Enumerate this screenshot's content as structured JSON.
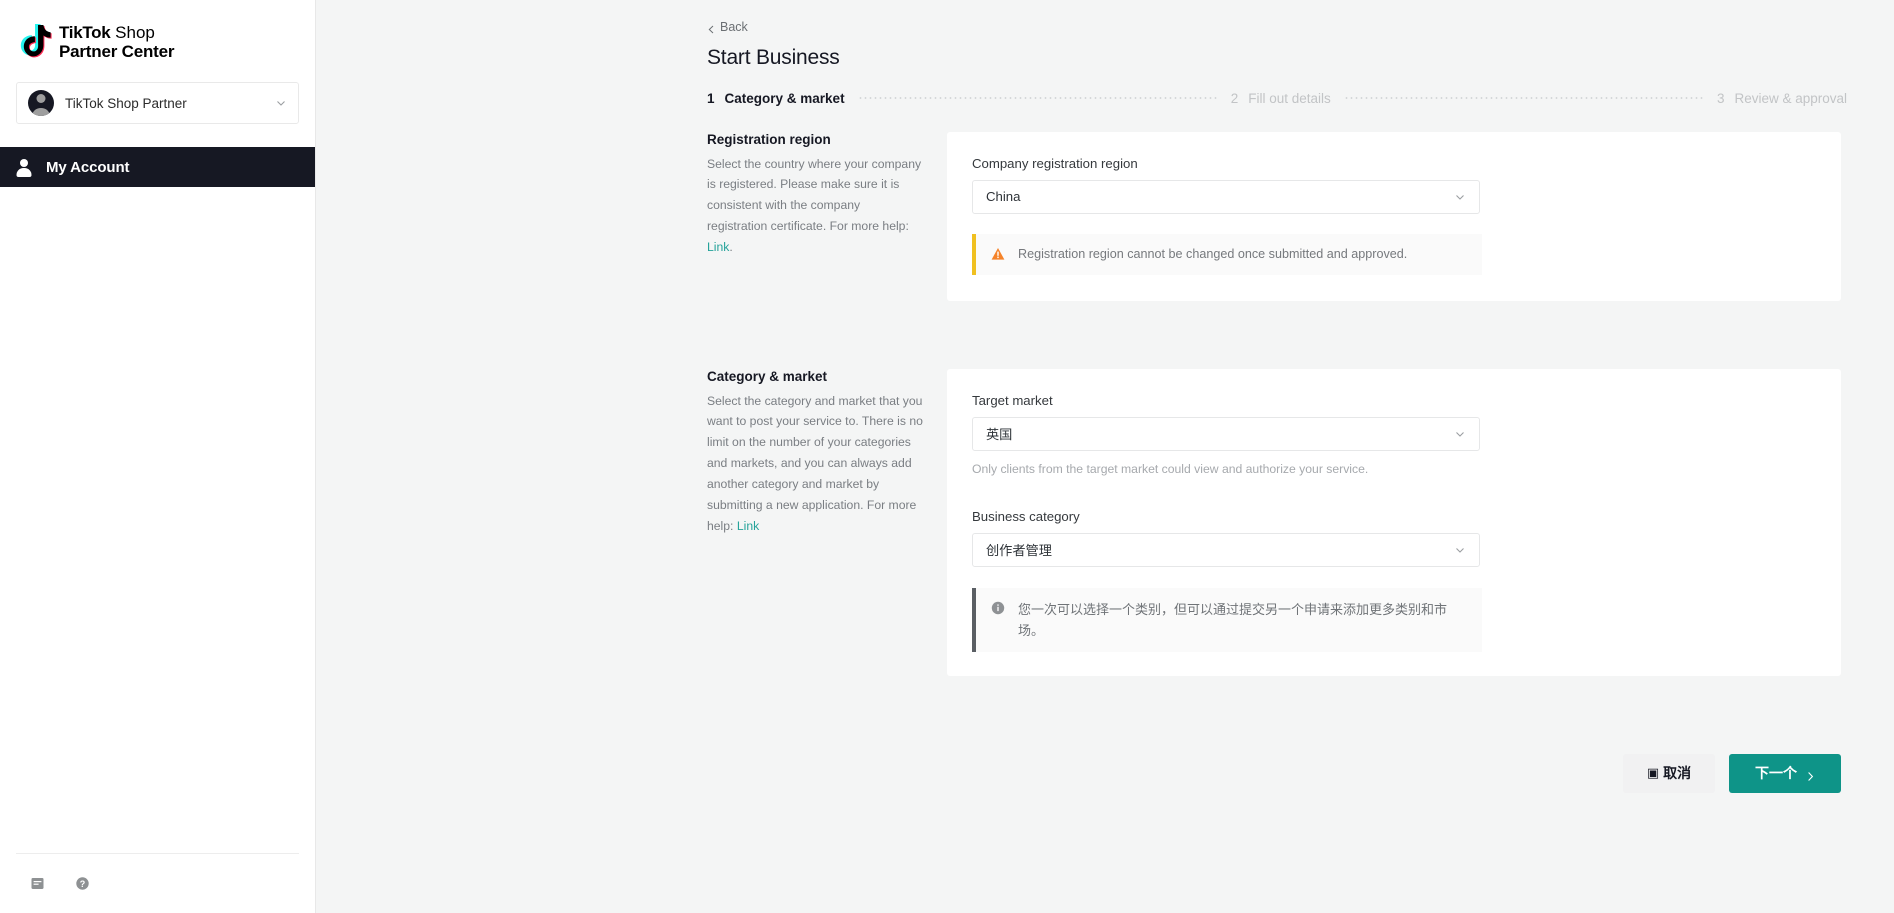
{
  "brand": {
    "logo_line1_bold": "TikTok",
    "logo_line1_rest": " Shop",
    "logo_line2": "Partner Center",
    "accent_teal": "#0e9488",
    "link_teal": "#25a39a",
    "dark": "#161823"
  },
  "sidebar": {
    "account_selector": {
      "name": "TikTok Shop Partner",
      "chevron_icon": "chevron-down-icon",
      "avatar_icon": "avatar-icon"
    },
    "nav_items": [
      {
        "label": "My Account",
        "icon": "person-icon",
        "active": true
      }
    ],
    "footer_icons": [
      {
        "name": "document-icon"
      },
      {
        "name": "help-circle-icon"
      }
    ]
  },
  "header": {
    "back_label": "Back",
    "back_icon": "chevron-left-icon",
    "title": "Start Business"
  },
  "stepper": {
    "steps": [
      {
        "num": "1",
        "label": "Category & market",
        "active": true
      },
      {
        "num": "2",
        "label": "Fill out details",
        "active": false
      },
      {
        "num": "3",
        "label": "Review & approval",
        "active": false
      }
    ]
  },
  "sections": [
    {
      "title": "Registration region",
      "description_prefix": "Select the country where your company is registered. Please make sure it is consistent with the company registration certificate. For more help: ",
      "description_link": "Link",
      "description_suffix": ".",
      "field_label": "Company registration region",
      "field_value": "China",
      "chevron_icon": "chevron-down-icon",
      "banner": {
        "type": "warning",
        "icon": "warning-triangle-icon",
        "text": "Registration region cannot be changed once submitted and approved.",
        "bar_color": "#f0c020"
      }
    },
    {
      "title": "Category & market",
      "description_prefix": "Select the category and market that you want to post your service to. There is no limit on the number of your categories and markets, and you can always add another category and market by submitting a new application. For more help: ",
      "description_link": "Link",
      "description_suffix": "",
      "target_market_label": "Target market",
      "target_market_value": "英国",
      "target_market_hint": "Only clients from the target market could view and authorize your service.",
      "business_category_label": "Business category",
      "business_category_value": "创作者管理",
      "chevron_icon": "chevron-down-icon",
      "banner": {
        "type": "info",
        "icon": "info-circle-icon",
        "text": "您一次可以选择一个类别，但可以通过提交另一个申请来添加更多类别和市场。",
        "bar_color": "#5a5e63"
      }
    }
  ],
  "actions": {
    "cancel_label": "取消",
    "cancel_glyph": "▣",
    "next_label": "下一个",
    "next_chevron_icon": "chevron-right-icon"
  }
}
